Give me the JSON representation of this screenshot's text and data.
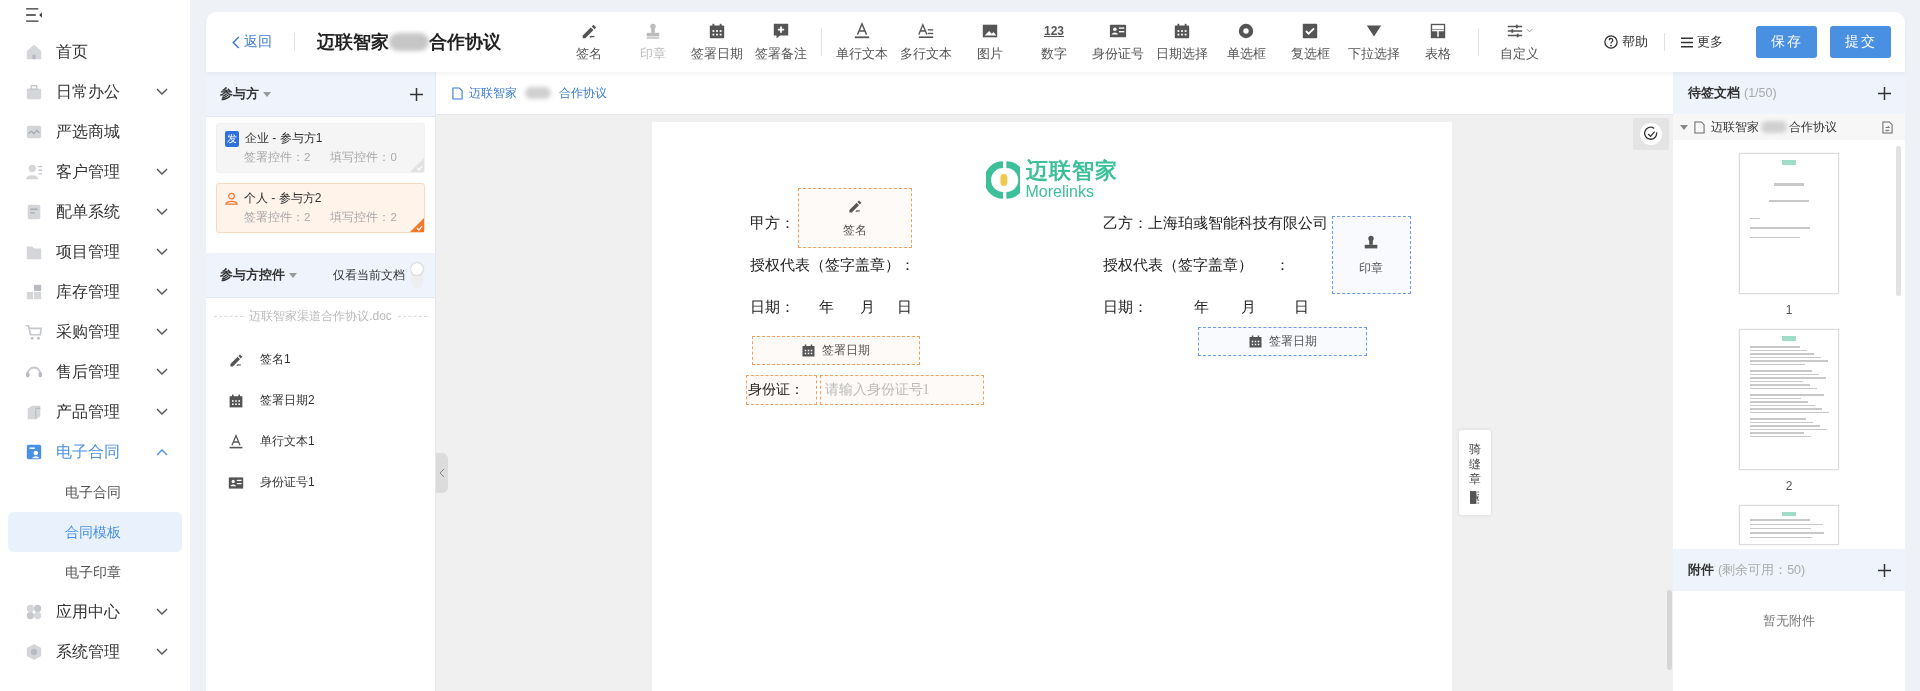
{
  "sidebar": {
    "items": [
      {
        "label": "首页",
        "kind": "link"
      },
      {
        "label": "日常办公",
        "kind": "group",
        "expanded": false
      },
      {
        "label": "严选商城",
        "kind": "link"
      },
      {
        "label": "客户管理",
        "kind": "group",
        "expanded": false
      },
      {
        "label": "配单系统",
        "kind": "group",
        "expanded": false
      },
      {
        "label": "项目管理",
        "kind": "group",
        "expanded": false
      },
      {
        "label": "库存管理",
        "kind": "group",
        "expanded": false
      },
      {
        "label": "采购管理",
        "kind": "group",
        "expanded": false
      },
      {
        "label": "售后管理",
        "kind": "group",
        "expanded": false
      },
      {
        "label": "产品管理",
        "kind": "group",
        "expanded": false
      },
      {
        "label": "电子合同",
        "kind": "group",
        "expanded": true,
        "children": [
          {
            "label": "电子合同",
            "selected": false
          },
          {
            "label": "合同模板",
            "selected": true
          },
          {
            "label": "电子印章",
            "selected": false
          }
        ]
      },
      {
        "label": "应用中心",
        "kind": "group",
        "expanded": false
      },
      {
        "label": "系统管理",
        "kind": "group",
        "expanded": false
      }
    ]
  },
  "toolbar": {
    "back": "返回",
    "title_start": "迈联智家",
    "title_end": "合作协议",
    "tools": [
      {
        "label": "签名",
        "disabled": false,
        "divider_before": false
      },
      {
        "label": "印章",
        "disabled": true,
        "divider_before": false
      },
      {
        "label": "签署日期",
        "disabled": false,
        "divider_before": false
      },
      {
        "label": "签署备注",
        "disabled": false,
        "divider_before": false
      },
      {
        "label": "单行文本",
        "disabled": false,
        "divider_before": true
      },
      {
        "label": "多行文本",
        "disabled": false,
        "divider_before": false
      },
      {
        "label": "图片",
        "disabled": false,
        "divider_before": false
      },
      {
        "label": "数字",
        "disabled": false,
        "divider_before": false,
        "glyph": "123"
      },
      {
        "label": "身份证号",
        "disabled": false,
        "divider_before": false
      },
      {
        "label": "日期选择",
        "disabled": false,
        "divider_before": false
      },
      {
        "label": "单选框",
        "disabled": false,
        "divider_before": false
      },
      {
        "label": "复选框",
        "disabled": false,
        "divider_before": false
      },
      {
        "label": "下拉选择",
        "disabled": false,
        "divider_before": false
      },
      {
        "label": "表格",
        "disabled": false,
        "divider_before": false
      },
      {
        "label": "自定义",
        "disabled": false,
        "divider_before": true
      }
    ],
    "help": "帮助",
    "more": "更多",
    "save": "保存",
    "submit": "提交"
  },
  "participants": {
    "title": "参与方",
    "parties": [
      {
        "kind": "company",
        "badge": "发",
        "name": "企业 - 参与方1",
        "sign_count": "签署控件：2",
        "fill_count": "填写控件：0",
        "selected": false
      },
      {
        "kind": "person",
        "name": "个人 - 参与方2",
        "sign_count": "签署控件：2",
        "fill_count": "填写控件：2",
        "selected": true
      }
    ]
  },
  "controls": {
    "title": "参与方控件",
    "toggle": {
      "label": "仅看当前文档",
      "on": false
    },
    "document": "迈联智家渠道合作协议.doc",
    "items": [
      {
        "label": "签名1",
        "kind": "signature"
      },
      {
        "label": "签署日期2",
        "kind": "date"
      },
      {
        "label": "单行文本1",
        "kind": "text"
      },
      {
        "label": "身份证号1",
        "kind": "idcard"
      }
    ]
  },
  "document_tab": {
    "name_start": "迈联智家",
    "name_end": "合作协议"
  },
  "document": {
    "logo_cn": "迈联智家",
    "logo_en": "Morelinks",
    "left": {
      "party": "甲方：",
      "rep": "授权代表（签字盖章）：",
      "date": "日期：",
      "year": "年",
      "month": "月",
      "day": "日"
    },
    "right": {
      "party": "乙方：上海珀彧智能科技有限公司",
      "rep": "授权代表（签字盖章）",
      "rep_colon": "：",
      "date": "日期：",
      "year": "年",
      "month": "月",
      "day": "日"
    },
    "fields": [
      {
        "kind": "signature",
        "label": "签名",
        "color": "#f5a05a"
      },
      {
        "kind": "seal",
        "label": "印章",
        "color": "#6f9af0"
      },
      {
        "kind": "date",
        "label": "签署日期",
        "color": "#f5a05a"
      },
      {
        "kind": "date",
        "label": "签署日期",
        "color": "#6f9af0"
      },
      {
        "kind": "label",
        "label": "身份证：",
        "color": "#f5a05a"
      },
      {
        "kind": "input",
        "placeholder": "请输入身份证号1",
        "color": "#f5a05a"
      }
    ]
  },
  "seam_seal": {
    "label": "骑缝章"
  },
  "documents_panel": {
    "title": "待签文档",
    "count": "(1/50)",
    "name_start": "迈联智家",
    "name_end": "合作协议",
    "pages": [
      "1",
      "2"
    ]
  },
  "attachments": {
    "title": "附件",
    "remaining": "(剩余可用：50)",
    "empty": "暂无附件"
  }
}
